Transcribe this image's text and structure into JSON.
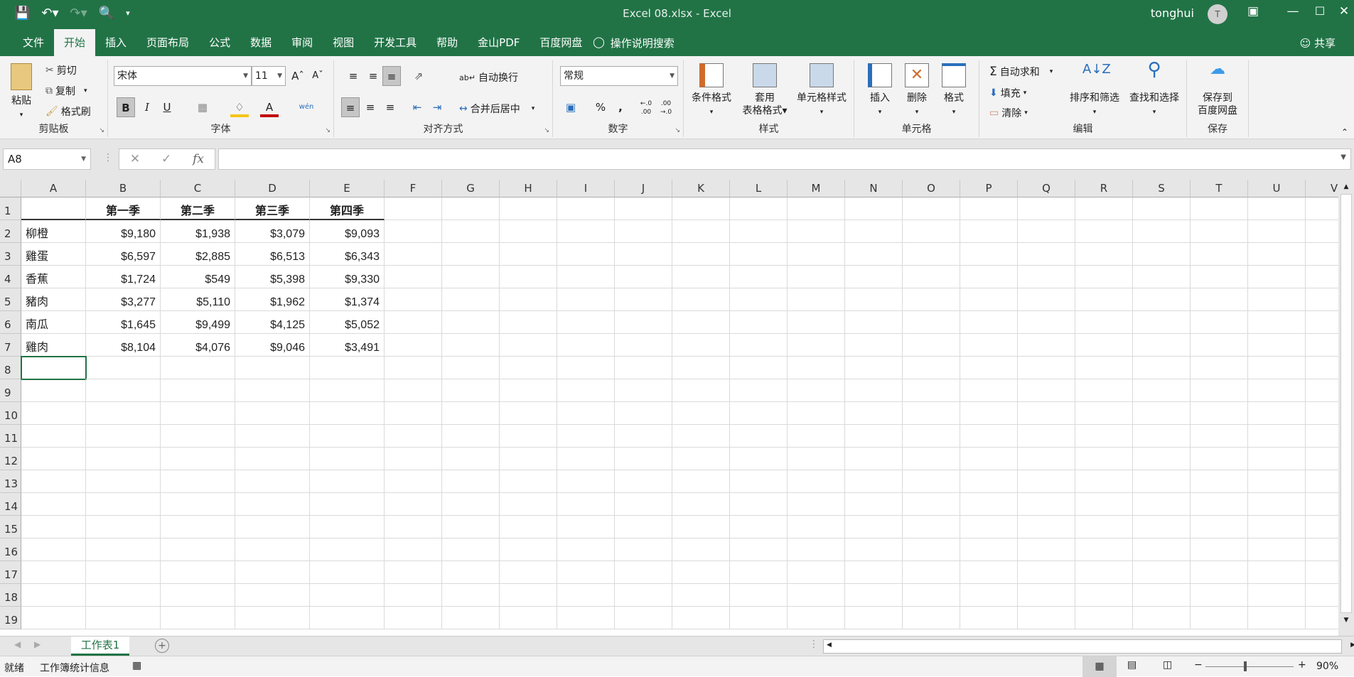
{
  "titlebar": {
    "title": "Excel 08.xlsx  -  Excel",
    "user": "tonghui",
    "avatar": "T",
    "qat": [
      "save-icon",
      "undo-icon",
      "redo-icon",
      "print-preview-icon",
      "customize-icon"
    ]
  },
  "tabs": [
    {
      "label": "文件"
    },
    {
      "label": "开始",
      "active": true
    },
    {
      "label": "插入"
    },
    {
      "label": "页面布局"
    },
    {
      "label": "公式"
    },
    {
      "label": "数据"
    },
    {
      "label": "审阅"
    },
    {
      "label": "视图"
    },
    {
      "label": "开发工具"
    },
    {
      "label": "帮助"
    },
    {
      "label": "金山PDF"
    },
    {
      "label": "百度网盘"
    }
  ],
  "tell_me": "操作说明搜索",
  "share": "共享",
  "ribbon": {
    "clipboard": {
      "label": "剪贴板",
      "paste": "粘贴",
      "cut": "剪切",
      "copy": "复制",
      "format_painter": "格式刷"
    },
    "font": {
      "label": "字体",
      "font_name": "宋体",
      "font_size": "11",
      "bold": "B",
      "italic": "I",
      "underline": "U",
      "phonetic": "wén"
    },
    "alignment": {
      "label": "对齐方式",
      "wrap": "自动换行",
      "merge": "合并后居中"
    },
    "number": {
      "label": "数字",
      "format": "常规",
      "percent": "%",
      "comma": ","
    },
    "styles": {
      "label": "样式",
      "conditional": "条件格式",
      "table_line1": "套用",
      "table_line2": "表格格式",
      "cell_styles": "单元格样式"
    },
    "cells": {
      "label": "单元格",
      "insert": "插入",
      "delete": "删除",
      "format": "格式"
    },
    "editing": {
      "label": "编辑",
      "autosum": "自动求和",
      "fill": "填充",
      "clear": "清除",
      "sort": "排序和筛选",
      "find": "查找和选择"
    },
    "save": {
      "label": "保存",
      "line1": "保存到",
      "line2": "百度网盘"
    }
  },
  "formula_bar": {
    "name_box": "A8",
    "fx": "fx",
    "value": ""
  },
  "sheet": {
    "columns": [
      "A",
      "B",
      "C",
      "D",
      "E",
      "F",
      "G",
      "H",
      "I",
      "J",
      "K",
      "L",
      "M",
      "N",
      "O",
      "P",
      "Q",
      "R",
      "S",
      "T",
      "U",
      "V"
    ],
    "rows": [
      "1",
      "2",
      "3",
      "4",
      "5",
      "6",
      "7",
      "8",
      "9",
      "10",
      "11",
      "12",
      "13",
      "14",
      "15",
      "16",
      "17",
      "18",
      "19"
    ],
    "header": [
      "",
      "第一季",
      "第二季",
      "第三季",
      "第四季"
    ],
    "data": [
      [
        "柳橙",
        "$9,180",
        "$1,938",
        "$3,079",
        "$9,093"
      ],
      [
        "雞蛋",
        "$6,597",
        "$2,885",
        "$6,513",
        "$6,343"
      ],
      [
        "香蕉",
        "$1,724",
        "$549",
        "$5,398",
        "$9,330"
      ],
      [
        "豬肉",
        "$3,277",
        "$5,110",
        "$1,962",
        "$1,374"
      ],
      [
        "南瓜",
        "$1,645",
        "$9,499",
        "$4,125",
        "$5,052"
      ],
      [
        "雞肉",
        "$8,104",
        "$4,076",
        "$9,046",
        "$3,491"
      ]
    ],
    "selected": "A8"
  },
  "sheet_tabs": [
    {
      "label": "工作表1",
      "active": true
    }
  ],
  "status": {
    "ready": "就绪",
    "stats": "工作簿统计信息",
    "zoom": "90%",
    "zoom_fraction": 0.45
  }
}
